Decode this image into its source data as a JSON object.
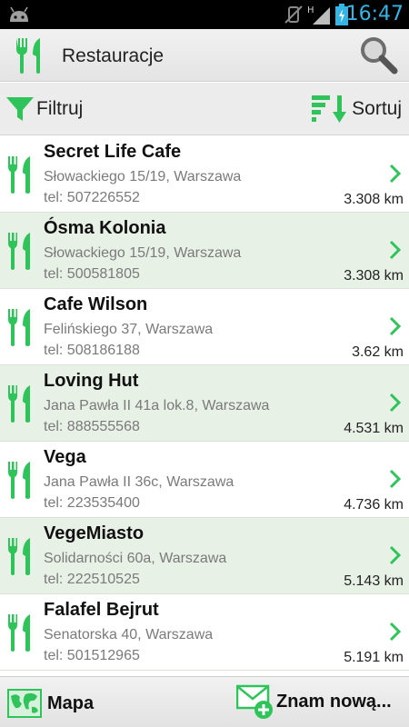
{
  "status_bar": {
    "time": "16:47",
    "network": "H"
  },
  "action_bar": {
    "title": "Restauracje"
  },
  "toolbar": {
    "filter_label": "Filtruj",
    "sort_label": "Sortuj"
  },
  "restaurants": [
    {
      "name": "Secret Life Cafe",
      "address": "Słowackiego 15/19, Warszawa",
      "phone": "tel: 507226552",
      "distance": "3.308 km"
    },
    {
      "name": "Ósma Kolonia",
      "address": "Słowackiego 15/19, Warszawa",
      "phone": "tel: 500581805",
      "distance": "3.308 km"
    },
    {
      "name": "Cafe Wilson",
      "address": "Felińskiego 37, Warszawa",
      "phone": "tel: 508186188",
      "distance": "3.62 km"
    },
    {
      "name": "Loving Hut",
      "address": "Jana Pawła II 41a lok.8, Warszawa",
      "phone": "tel: 888555568",
      "distance": "4.531 km"
    },
    {
      "name": "Vega",
      "address": "Jana Pawła II 36c, Warszawa",
      "phone": "tel: 223535400",
      "distance": "4.736 km"
    },
    {
      "name": "VegeMiasto",
      "address": "Solidarności 60a, Warszawa",
      "phone": "tel: 222510525",
      "distance": "5.143 km"
    },
    {
      "name": "Falafel Bejrut",
      "address": "Senatorska 40, Warszawa",
      "phone": "tel: 501512965",
      "distance": "5.191 km"
    }
  ],
  "bottom_bar": {
    "map_label": "Mapa",
    "new_label": "Znam nową..."
  },
  "colors": {
    "accent_green": "#2ec45a",
    "status_blue": "#33b5e5",
    "alt_row": "#e8f1e6"
  }
}
